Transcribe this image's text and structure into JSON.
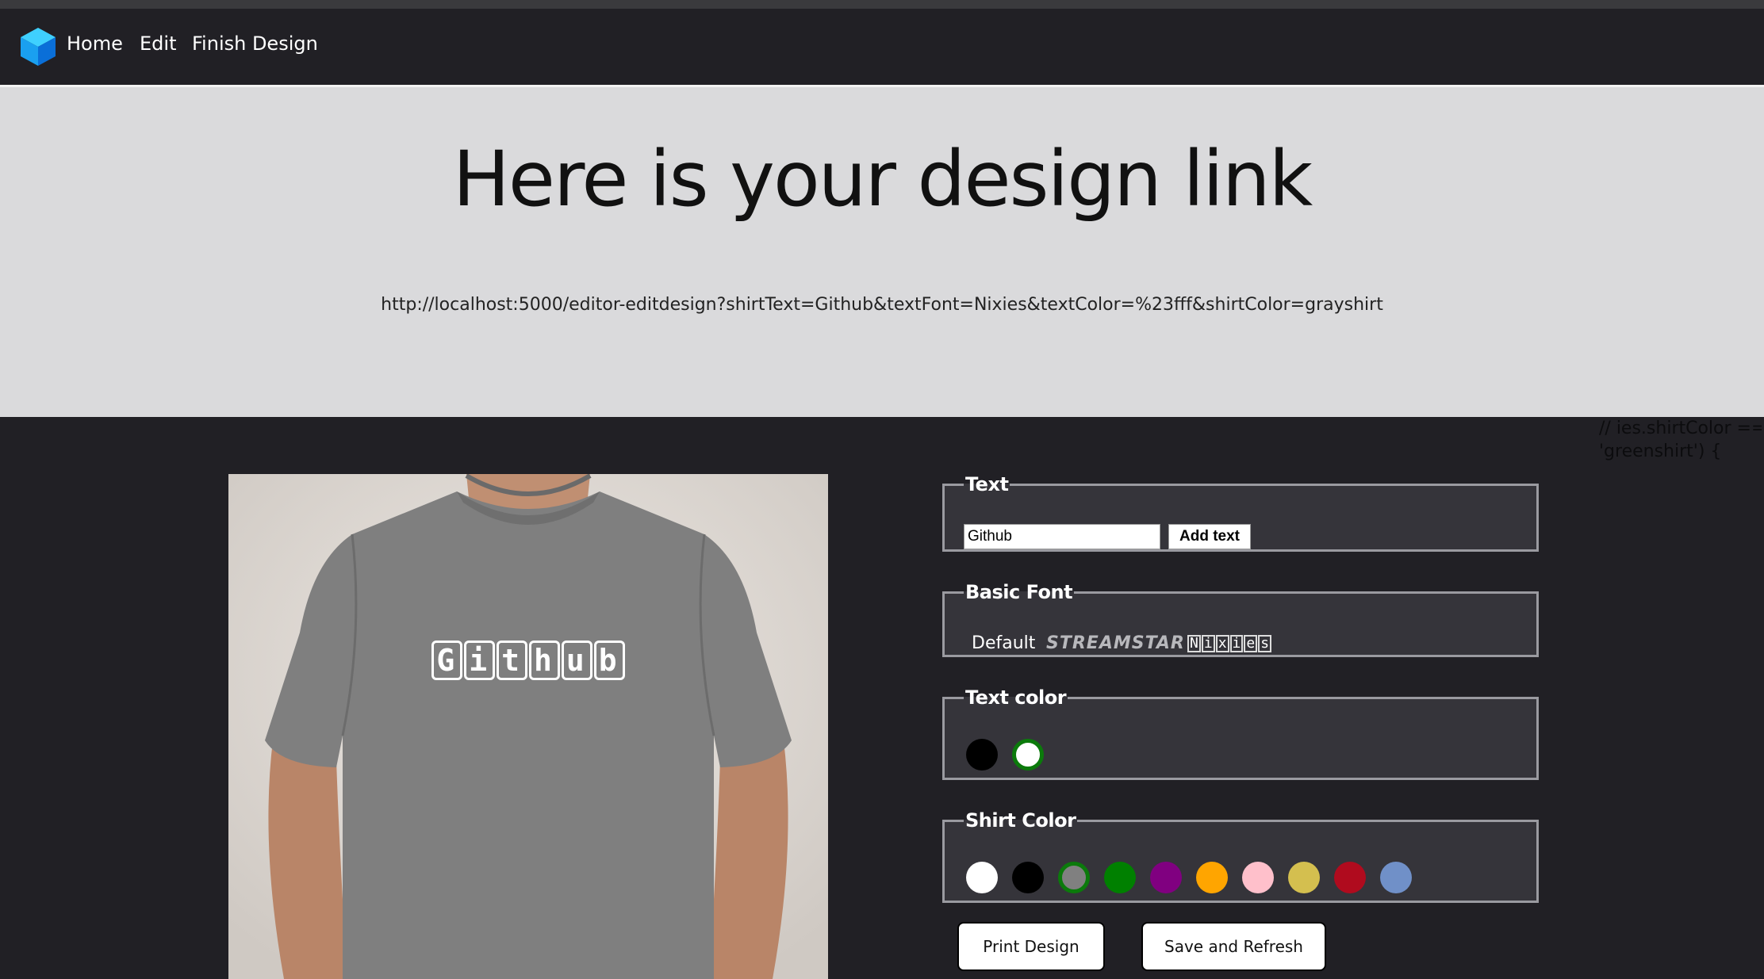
{
  "nav": {
    "logo_icon": "cube-icon",
    "links": [
      "Home",
      "Edit",
      "Finish Design"
    ]
  },
  "hero": {
    "title": "Here is your design link",
    "link": "http://localhost:5000/editor-editdesign?shirtText=Github&textFont=Nixies&textColor=%23fff&shirtColor=grayshirt"
  },
  "code_note": [
    "// ies.shirtColor ==",
    "'greenshirt') {"
  ],
  "shirt": {
    "color": "#7f7f7f",
    "text": "Github",
    "text_color": "#ffffff"
  },
  "text_group": {
    "legend": "Text",
    "input_value": "Github",
    "add_button": "Add text"
  },
  "font_group": {
    "legend": "Basic Font",
    "options": [
      "Default",
      "STREAMSTAR",
      "Nixies"
    ]
  },
  "text_color_group": {
    "legend": "Text color",
    "colors": [
      "#000000",
      "#ffffff"
    ],
    "selected": "#ffffff"
  },
  "shirt_color_group": {
    "legend": "Shirt Color",
    "colors": [
      "#ffffff",
      "#000000",
      "#808080",
      "#008000",
      "#800080",
      "#ffa500",
      "#ffc0cb",
      "#d4bf4f",
      "#b00b1e",
      "#7090c8"
    ],
    "selected": "#808080"
  },
  "actions": {
    "print": "Print Design",
    "save": "Save and Refresh"
  }
}
